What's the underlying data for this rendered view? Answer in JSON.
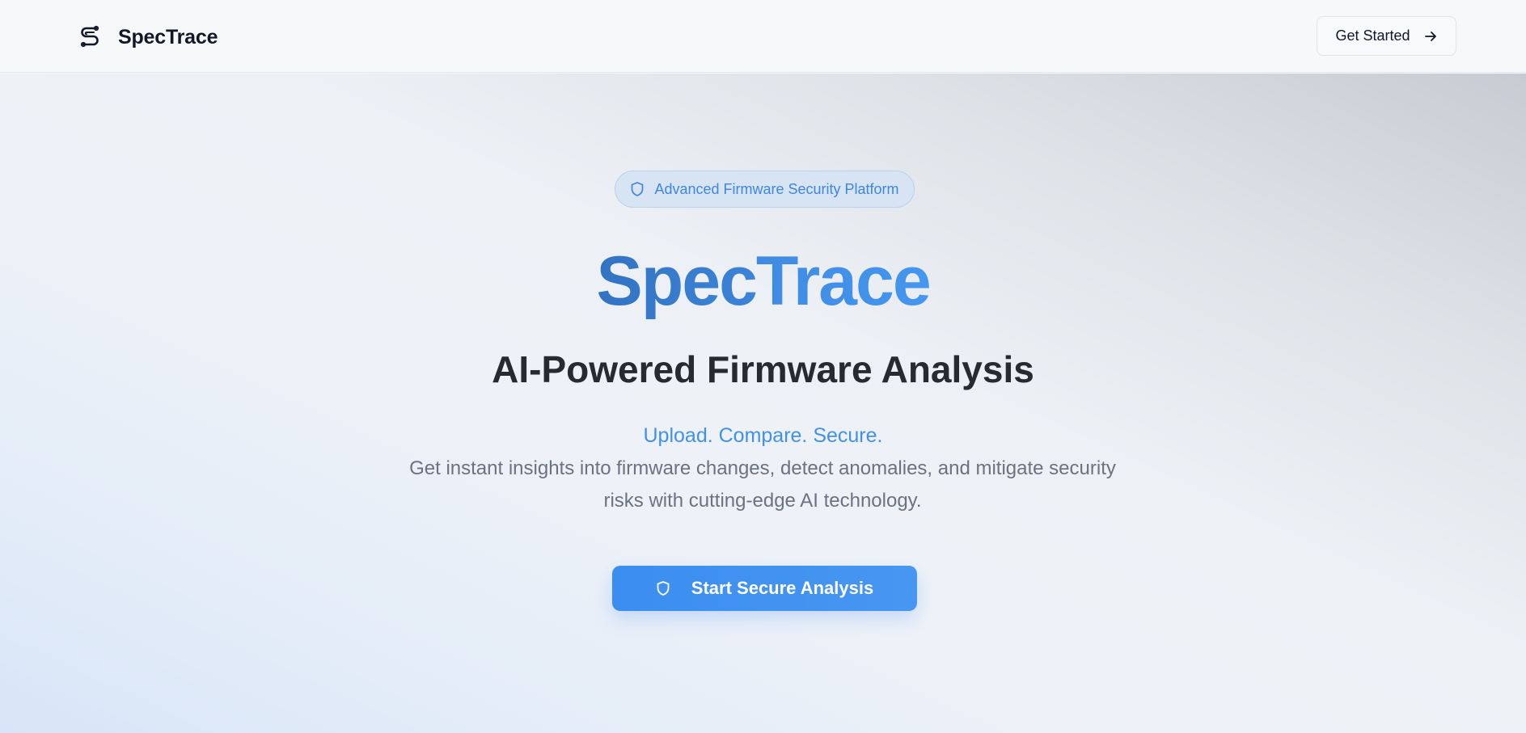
{
  "header": {
    "brand_name": "SpecTrace",
    "brand_icon": "s-logo-icon",
    "get_started_label": "Get Started",
    "get_started_icon": "arrow-right-icon"
  },
  "hero": {
    "badge": {
      "icon": "shield-icon",
      "label": "Advanced Firmware Security Platform"
    },
    "title_part1": "Spec",
    "title_part2": "Trace",
    "subtitle": "AI-Powered Firmware Analysis",
    "tagline": "Upload. Compare. Secure.",
    "description": "Get instant insights into firmware changes, detect anomalies, and mitigate security risks with cutting-edge AI technology.",
    "cta": {
      "icon": "shield-icon",
      "label": "Start Secure Analysis"
    }
  },
  "colors": {
    "accent": "#4191ea",
    "title_dark": "#3273c2",
    "heading": "#262a31",
    "body_text": "#6b7280",
    "cta_background": "#3b8ef0"
  }
}
